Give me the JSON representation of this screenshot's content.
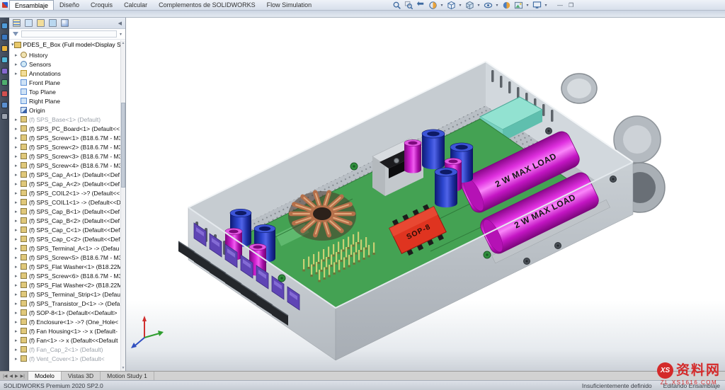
{
  "app": {
    "status_left": "SOLIDWORKS Premium 2020 SP2.0"
  },
  "top_bar": {
    "tabs": [
      {
        "label": "Ensamblaje",
        "active": true
      },
      {
        "label": "Diseño"
      },
      {
        "label": "Croquis"
      },
      {
        "label": "Calcular"
      },
      {
        "label": "Complementos de SOLIDWORKS"
      },
      {
        "label": "Flow Simulation"
      }
    ],
    "hud_icons": [
      "zoom-fit",
      "zoom-area",
      "previous-view",
      "section-view",
      "view-orientation",
      "display-style",
      "hide-show-items",
      "edit-appearance",
      "apply-scene",
      "view-settings"
    ],
    "dropdown_glyph": "▾",
    "minimize_glyph": "—",
    "restore_glyph": "❐"
  },
  "left_toolbar": {
    "icons": [
      "left-tool-1",
      "left-tool-2",
      "left-tool-3",
      "left-tool-4",
      "left-tool-5",
      "left-tool-6",
      "left-tool-7",
      "left-tool-8",
      "left-tool-9"
    ]
  },
  "feature_tree": {
    "header_tabs": [
      "featuremanager",
      "propertymanager",
      "configurationmanager",
      "dimxpertmanager",
      "displaymanager"
    ],
    "collapse_glyph": "◀",
    "root_arrow_glyph": "▾",
    "root": "PDES_E_Box (Full model<Display Stat",
    "items": [
      {
        "label": "History",
        "icon": "history",
        "arrow": true
      },
      {
        "label": "Sensors",
        "icon": "sensors",
        "arrow": true
      },
      {
        "label": "Annotations",
        "icon": "annotations",
        "arrow": true
      },
      {
        "label": "Front Plane",
        "icon": "plane",
        "arrow": false
      },
      {
        "label": "Top Plane",
        "icon": "plane",
        "arrow": false
      },
      {
        "label": "Right Plane",
        "icon": "plane",
        "arrow": false
      },
      {
        "label": "Origin",
        "icon": "origin",
        "arrow": false
      },
      {
        "label": "(f) SPS_Base<1> (Default)",
        "icon": "part",
        "arrow": true,
        "muted": true
      },
      {
        "label": "(f) SPS_PC_Board<1> (Default<<",
        "icon": "part",
        "arrow": true
      },
      {
        "label": "(f) SPS_Screw<1> (B18.6.7M - M3",
        "icon": "part",
        "arrow": true
      },
      {
        "label": "(f) SPS_Screw<2> (B18.6.7M - M3",
        "icon": "part",
        "arrow": true
      },
      {
        "label": "(f) SPS_Screw<3> (B18.6.7M - M3",
        "icon": "part",
        "arrow": true
      },
      {
        "label": "(f) SPS_Screw<4> (B18.6.7M - M3",
        "icon": "part",
        "arrow": true
      },
      {
        "label": "(f) SPS_Cap_A<1> (Default<<Def",
        "icon": "part",
        "arrow": true
      },
      {
        "label": "(f) SPS_Cap_A<2> (Default<<Def",
        "icon": "part",
        "arrow": true
      },
      {
        "label": "(f) SPS_COIL2<1> ->? (Default<<",
        "icon": "part",
        "arrow": true
      },
      {
        "label": "(f) SPS_COIL1<1> -> (Default<<D",
        "icon": "part",
        "arrow": true
      },
      {
        "label": "(f) SPS_Cap_B<1> (Default<<Def",
        "icon": "part",
        "arrow": true
      },
      {
        "label": "(f) SPS_Cap_B<2> (Default<<Def",
        "icon": "part",
        "arrow": true
      },
      {
        "label": "(f) SPS_Cap_C<1> (Default<<Def",
        "icon": "part",
        "arrow": true
      },
      {
        "label": "(f) SPS_Cap_C<2> (Default<<Def",
        "icon": "part",
        "arrow": true
      },
      {
        "label": "(f) SPS_Terminal_A<1> -> (Defau",
        "icon": "part",
        "arrow": true
      },
      {
        "label": "(f) SPS_Screw<5> (B18.6.7M - M3",
        "icon": "part",
        "arrow": true
      },
      {
        "label": "(f) SPS_Flat Washer<1> (B18.22M",
        "icon": "part",
        "arrow": true
      },
      {
        "label": "(f) SPS_Screw<6> (B18.6.7M - M3",
        "icon": "part",
        "arrow": true
      },
      {
        "label": "(f) SPS_Flat Washer<2> (B18.22M",
        "icon": "part",
        "arrow": true
      },
      {
        "label": "(f) SPS_Terminal_Strip<1> (Defau",
        "icon": "part",
        "arrow": true
      },
      {
        "label": "(f) SPS_Transistor_D<1> -> (Defa",
        "icon": "part",
        "arrow": true
      },
      {
        "label": "(f) SOP-8<1> (Default<<Default>",
        "icon": "part",
        "arrow": true
      },
      {
        "label": "(f) Enclosure<1> ->? (One_Hole<",
        "icon": "part",
        "arrow": true
      },
      {
        "label": "(f) Fan Housing<1> -> x (Default-",
        "icon": "part",
        "arrow": true
      },
      {
        "label": "(f) Fan<1> -> x (Default<<Default",
        "icon": "part",
        "arrow": true
      },
      {
        "label": "(f) Fan_Cap_2<1> (Default)",
        "icon": "part",
        "arrow": true,
        "muted": true
      },
      {
        "label": "(f) Vent_Cover<1> (Default<",
        "icon": "part",
        "arrow": true,
        "muted": true
      }
    ]
  },
  "viewport": {
    "max_load_label": "2 W MAX LOAD",
    "chip_label": "SOP-8"
  },
  "bottom_tabs": {
    "nav": [
      "|◀",
      "◀",
      "▶",
      "▶|"
    ],
    "tabs": [
      {
        "label": "Modelo",
        "active": true
      },
      {
        "label": "Vistas 3D"
      },
      {
        "label": "Motion Study 1"
      }
    ]
  },
  "status_bar": {
    "left": "SOLIDWORKS Premium 2020 SP2.0",
    "definition_state": "Insuficientemente definido",
    "mode": "Editando Ensamblaje"
  },
  "watermark": {
    "badge": "XS",
    "name": "资料网",
    "url": "ZL.XS1616.COM"
  }
}
